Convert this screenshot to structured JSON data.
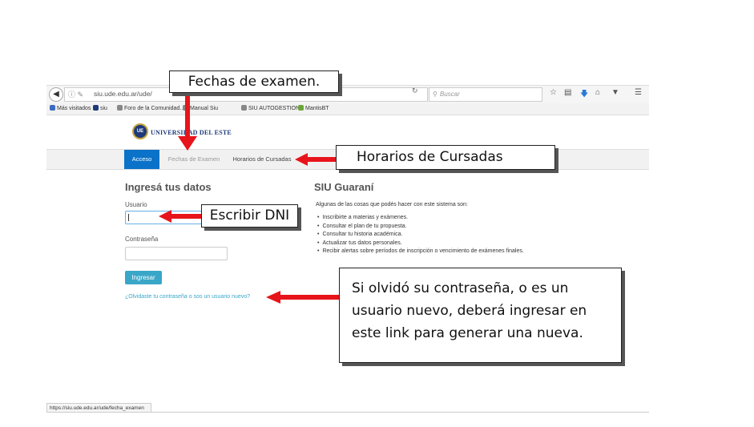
{
  "browser": {
    "url": "siu.ude.edu.ar/ude/",
    "search_placeholder": "Buscar",
    "bookmarks": [
      {
        "label": "Más visitados",
        "icon": "bookmark-icon",
        "color": "#3b6bc2"
      },
      {
        "label": "siu",
        "icon": "siu-icon",
        "color": "#1f3a7a"
      },
      {
        "label": "Foro de la Comunidad...",
        "icon": "globe-icon",
        "color": "#888888"
      },
      {
        "label": "Manual Siu",
        "icon": "globe-icon",
        "color": "#888888"
      },
      {
        "label": "SIU AUTOGESTION",
        "icon": "globe-icon",
        "color": "#888888"
      },
      {
        "label": "MantisBT",
        "icon": "mantis-icon",
        "color": "#6aa53a"
      }
    ],
    "status_url": "https://siu.ude.edu.ar/ude/fecha_examen"
  },
  "site": {
    "logo_text": "UNIVERSIDAD DEL ESTE",
    "logo_badge": "UE",
    "nav": [
      "Acceso",
      "Fechas de Examen",
      "Horarios de Cursadas"
    ],
    "accent": "#0a72c8"
  },
  "login": {
    "title": "Ingresá tus datos",
    "user_label": "Usuario",
    "password_label": "Contraseña",
    "submit": "Ingresar",
    "forgot_link": "¿Olvidaste tu contraseña o sos un usuario nuevo?"
  },
  "siu": {
    "title": "SIU Guaraní",
    "intro": "Algunas de las cosas que podés hacer con este sistema son:",
    "items": [
      "Inscribirte a materias y exámenes.",
      "Consultar el plan de tu propuesta.",
      "Consultar tu historia académica.",
      "Actualizar tus datos personales.",
      "Recibir alertas sobre períodos de inscripción o vencimiento de exámenes finales."
    ]
  },
  "annotations": {
    "fechas": "Fechas de examen.",
    "horarios": "Horarios de Cursadas",
    "dni": "Escribir DNI",
    "password_note": [
      "Si olvidó su contraseña, o es un",
      "usuario nuevo, deberá ingresar en",
      "este link para generar una nueva."
    ],
    "arrow_color": "#e8141b"
  }
}
